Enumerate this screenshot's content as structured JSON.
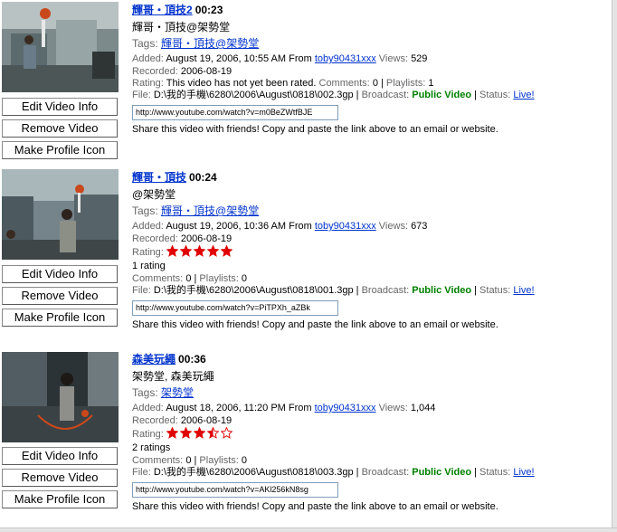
{
  "buttons": {
    "edit_info": "Edit Video Info",
    "remove": "Remove Video",
    "profile_icon": "Make Profile Icon"
  },
  "labels": {
    "tags": "Tags:",
    "added": "Added:",
    "from": "From",
    "views": "Views:",
    "recorded": "Recorded:",
    "rating": "Rating:",
    "comments": "Comments:",
    "playlists": "Playlists:",
    "file": "File:",
    "broadcast": "Broadcast:",
    "status": "Status:",
    "share_note": "Share this video with friends! Copy and paste the link above to an email or website."
  },
  "colors": {
    "link": "#0033cc",
    "public": "#008000",
    "star": "#e00000"
  },
  "videos": [
    {
      "title": "輝哥・頂技2",
      "duration": "00:23",
      "description": "輝哥・頂技@架勢堂",
      "tags": "輝哥・頂技@架勢堂",
      "added": "August 19, 2006, 10:55 AM",
      "from_user": "toby90431xxx",
      "views": "529",
      "recorded": "2006-08-19",
      "rating_text": "This video has not yet been rated.",
      "rating_stars": 0,
      "rating_count": "",
      "comments": "0",
      "playlists": "1",
      "file": "D:\\我的手機\\6280\\2006\\August\\0818\\002.3gp",
      "broadcast": "Public Video",
      "status": "Live!",
      "url": "http://www.youtube.com/watch?v=m0BeZWtfBJE"
    },
    {
      "title": "輝哥・頂技",
      "duration": "00:24",
      "description": "@架勢堂",
      "tags": "輝哥・頂技@架勢堂",
      "added": "August 19, 2006, 10:36 AM",
      "from_user": "toby90431xxx",
      "views": "673",
      "recorded": "2006-08-19",
      "rating_text": "",
      "rating_stars": 5,
      "rating_count": "1 rating",
      "comments": "0",
      "playlists": "0",
      "file": "D:\\我的手機\\6280\\2006\\August\\0818\\001.3gp",
      "broadcast": "Public Video",
      "status": "Live!",
      "url": "http://www.youtube.com/watch?v=PiTPXh_aZBk"
    },
    {
      "title": "森美玩繩",
      "duration": "00:36",
      "description": "架勢堂, 森美玩繩",
      "tags": "架勢堂",
      "added": "August 18, 2006, 11:20 PM",
      "from_user": "toby90431xxx",
      "views": "1,044",
      "recorded": "2006-08-19",
      "rating_text": "",
      "rating_stars": 3.5,
      "rating_count": "2 ratings",
      "comments": "0",
      "playlists": "0",
      "file": "D:\\我的手機\\6280\\2006\\August\\0818\\003.3gp",
      "broadcast": "Public Video",
      "status": "Live!",
      "url": "http://www.youtube.com/watch?v=AKl256kN8sg"
    }
  ]
}
